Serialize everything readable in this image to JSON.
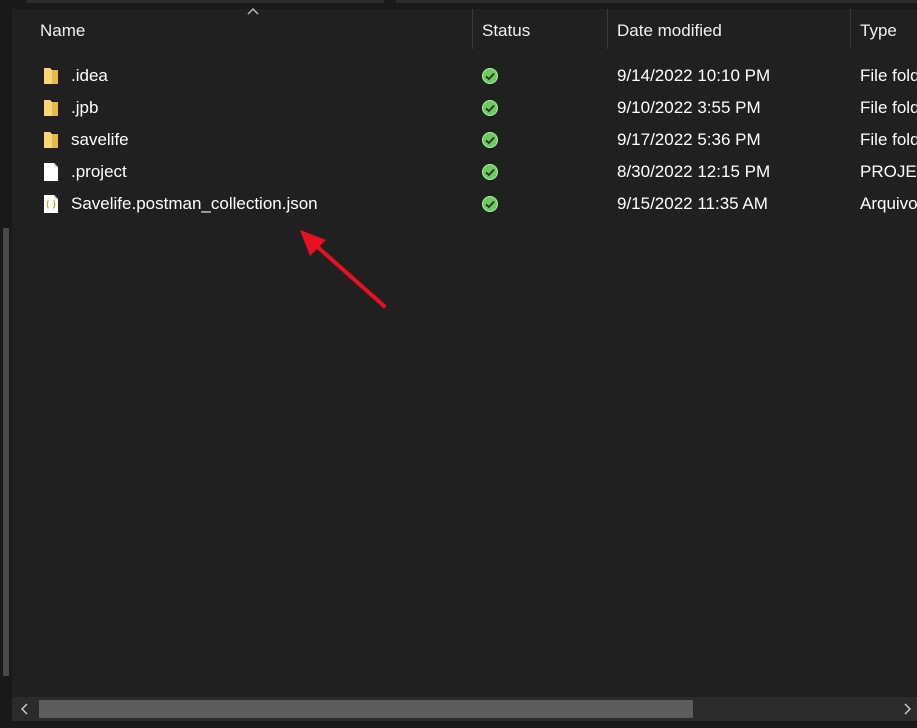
{
  "columns": {
    "name": "Name",
    "status": "Status",
    "date_modified": "Date modified",
    "type": "Type"
  },
  "files": [
    {
      "name": ".idea",
      "icon": "folder-icon",
      "status": "synced-icon",
      "date": "9/14/2022 10:10 PM",
      "type": "File folder"
    },
    {
      "name": ".jpb",
      "icon": "folder-icon",
      "status": "synced-icon",
      "date": "9/10/2022 3:55 PM",
      "type": "File folder"
    },
    {
      "name": "savelife",
      "icon": "folder-icon",
      "status": "synced-icon",
      "date": "9/17/2022 5:36 PM",
      "type": "File folder"
    },
    {
      "name": ".project",
      "icon": "file-icon",
      "status": "synced-icon",
      "date": "8/30/2022 12:15 PM",
      "type": "PROJECT File"
    },
    {
      "name": "Savelife.postman_collection.json",
      "icon": "json-file-icon",
      "status": "synced-icon",
      "date": "9/15/2022 11:35 AM",
      "type": "Arquivo JSON"
    }
  ],
  "colors": {
    "background": "#202020",
    "folder": "#f8d775",
    "status_ok": "#6ccb5f",
    "annotation_arrow": "#e81123"
  }
}
